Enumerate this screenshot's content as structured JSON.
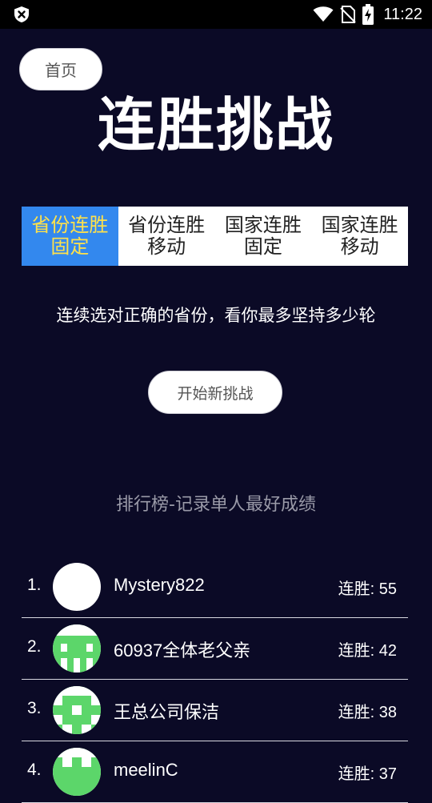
{
  "status_bar": {
    "time": "11:22",
    "icons": [
      "shield-icon",
      "wifi-icon",
      "no-sim-icon",
      "battery-charging-icon"
    ]
  },
  "header": {
    "home_label": "首页",
    "title": "连胜挑战"
  },
  "tabs": [
    {
      "line1": "省份连胜",
      "line2": "固定",
      "active": true
    },
    {
      "line1": "省份连胜",
      "line2": "移动",
      "active": false
    },
    {
      "line1": "国家连胜",
      "line2": "固定",
      "active": false
    },
    {
      "line1": "国家连胜",
      "line2": "移动",
      "active": false
    }
  ],
  "description": "连续选对正确的省份，看你最多坚持多少轮",
  "start_label": "开始新挑战",
  "leaderboard": {
    "title": "排行榜-记录单人最好成绩",
    "rows": [
      {
        "rank": "1.",
        "name": "Mystery822",
        "score": "连胜: 55",
        "avatar": "blank"
      },
      {
        "rank": "2.",
        "name": "60937全体老父亲",
        "score": "连胜: 42",
        "avatar": "green-pattern"
      },
      {
        "rank": "3.",
        "name": "王总公司保洁",
        "score": "连胜: 38",
        "avatar": "green-pattern"
      },
      {
        "rank": "4.",
        "name": "meelinC",
        "score": "连胜: 37",
        "avatar": "green-pattern"
      }
    ]
  },
  "colors": {
    "background": "#0b0a26",
    "tab_active_bg": "#3388ee",
    "tab_active_text": "#ffe14a",
    "avatar_green": "#5cd66a"
  }
}
